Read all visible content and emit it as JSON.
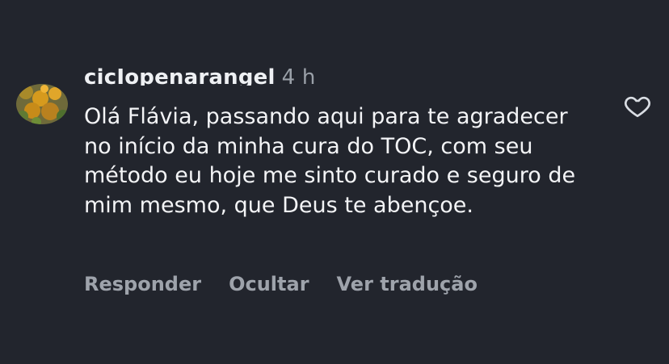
{
  "comment": {
    "username": "cicIopenarangel",
    "timestamp": "4 h",
    "text": "Olá Flávia, passando aqui para te agradecer no início da minha cura do TOC, com seu método eu hoje me sinto curado e seguro de mim mesmo, que Deus te abençoe.",
    "actions": {
      "reply_label": "Responder",
      "hide_label": "Ocultar",
      "translate_label": "Ver tradução"
    }
  },
  "icons": {
    "like": "heart-icon"
  },
  "colors": {
    "background": "#22252d",
    "text": "#f3f4f6",
    "muted": "#9ea3ab"
  }
}
